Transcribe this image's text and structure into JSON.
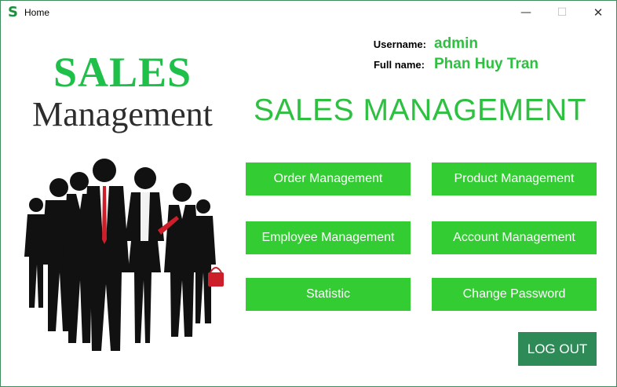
{
  "window": {
    "title": "Home",
    "icon_letter": "S",
    "minimize": "—",
    "maximize": "☐",
    "close": "✕"
  },
  "logo": {
    "line1": "SALES",
    "line2": "Management"
  },
  "user": {
    "username_label": "Username:",
    "username_value": "admin",
    "fullname_label": "Full name:",
    "fullname_value": "Phan Huy Tran"
  },
  "main_title": "SALES MANAGEMENT",
  "buttons": {
    "order": "Order Management",
    "product": "Product Management",
    "employee": "Employee Management",
    "account": "Account Management",
    "statistic": "Statistic",
    "change_password": "Change Password",
    "logout": "LOG OUT"
  },
  "colors": {
    "accent_green": "#33cc33",
    "title_green": "#2ec040",
    "logout_green": "#2e8b57",
    "tie_red": "#cc1f2a"
  }
}
